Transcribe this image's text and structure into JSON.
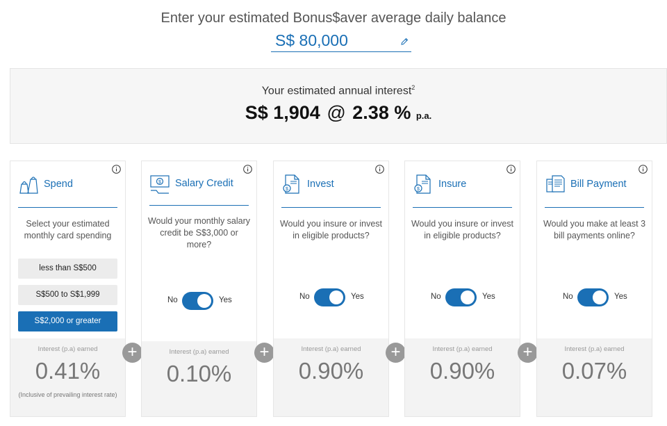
{
  "header": {
    "prompt": "Enter your estimated Bonus$aver average daily balance",
    "balance_value": "S$ 80,000"
  },
  "summary": {
    "label": "Your estimated annual interest",
    "footnote": "2",
    "amount": "S$ 1,904",
    "at": "@",
    "rate": "2.38 %",
    "rate_suffix": "p.a."
  },
  "cards": [
    {
      "title": "Spend",
      "question": "Select your estimated monthly card spending",
      "options": [
        "less than S$500",
        "S$500 to S$1,999",
        "S$2,000 or greater"
      ],
      "selected_option": "S$2,000 or greater",
      "interest_label": "Interest (p.a) earned",
      "interest_value": "0.41%",
      "interest_note": "(Inclusive of prevailing interest rate)"
    },
    {
      "title": "Salary Credit",
      "question": "Would your monthly salary credit be S$3,000 or more?",
      "toggle_no": "No",
      "toggle_yes": "Yes",
      "toggle_on": true,
      "interest_label": "Interest (p.a) earned",
      "interest_value": "0.10%"
    },
    {
      "title": "Invest",
      "question": "Would you insure or invest in eligible products?",
      "toggle_no": "No",
      "toggle_yes": "Yes",
      "toggle_on": true,
      "interest_label": "Interest (p.a) earned",
      "interest_value": "0.90%"
    },
    {
      "title": "Insure",
      "question": "Would you insure or invest in eligible products?",
      "toggle_no": "No",
      "toggle_yes": "Yes",
      "toggle_on": true,
      "interest_label": "Interest (p.a) earned",
      "interest_value": "0.90%"
    },
    {
      "title": "Bill Payment",
      "question": "Would you make at least 3 bill payments online?",
      "toggle_no": "No",
      "toggle_yes": "Yes",
      "toggle_on": true,
      "interest_label": "Interest (p.a) earned",
      "interest_value": "0.07%"
    }
  ],
  "plus_symbol": "+",
  "icons": {
    "edit": "pencil-icon",
    "info": "info-icon",
    "spend": "shopping-bags-icon",
    "salary": "salary-money-icon",
    "invest": "document-dollar-icon",
    "insure": "document-dollar-icon",
    "bill": "bill-documents-icon"
  },
  "colors": {
    "accent": "#1a6fb5",
    "option_bg": "#ececec",
    "plus_bg": "#999999",
    "summary_bg": "#f6f6f6",
    "interest_bg": "#f3f3f3"
  }
}
